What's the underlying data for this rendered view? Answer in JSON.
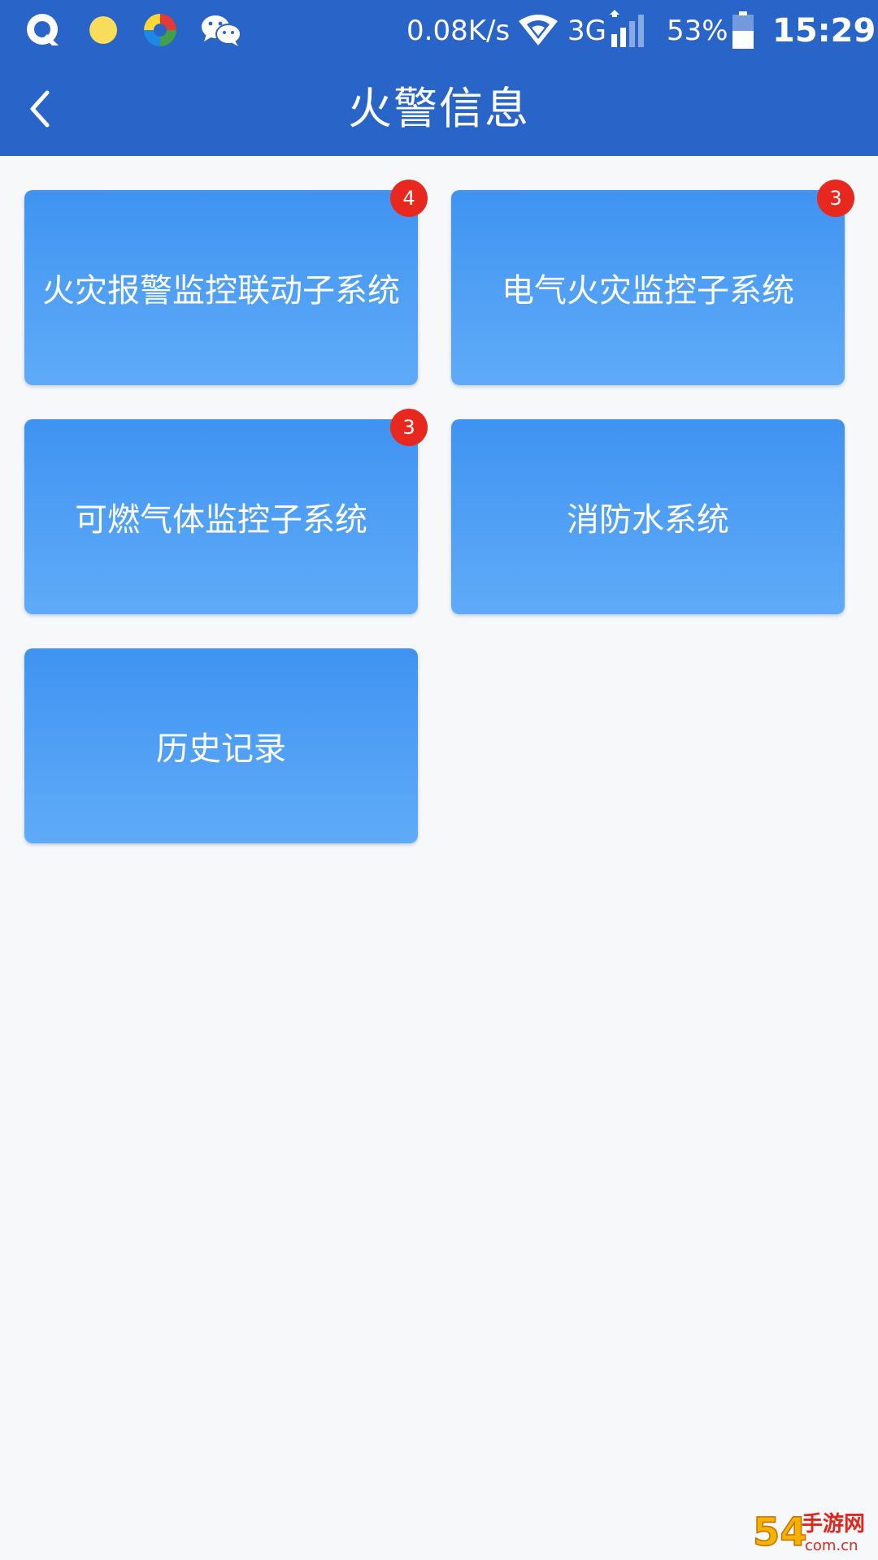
{
  "status_bar": {
    "icons": [
      "q-app-icon",
      "yellow-dot-icon",
      "colorful-app-icon",
      "wechat-icon",
      "wifi-icon",
      "signal-bars-icon",
      "battery-icon"
    ],
    "network_speed": "0.08K/s",
    "network_type": "3G",
    "battery_percent": "53%",
    "battery_level": 0.53,
    "time": "15:29"
  },
  "header": {
    "title": "火警信息",
    "back_icon": "chevron-left-icon"
  },
  "tiles": [
    {
      "label": "火灾报警监控联动子系统",
      "badge": "4"
    },
    {
      "label": "电气火灾监控子系统",
      "badge": "3"
    },
    {
      "label": "可燃气体监控子系统",
      "badge": "3"
    },
    {
      "label": "消防水系统",
      "badge": ""
    },
    {
      "label": "历史记录",
      "badge": ""
    }
  ],
  "colors": {
    "header_bg": "#2964c9",
    "tile_top": "#3f93f1",
    "tile_bottom": "#5fabf8",
    "badge_bg": "#e8271f",
    "page_bg": "#f7f8fa"
  },
  "watermark": {
    "brand": "54手游网",
    "domain": "com.cn"
  }
}
